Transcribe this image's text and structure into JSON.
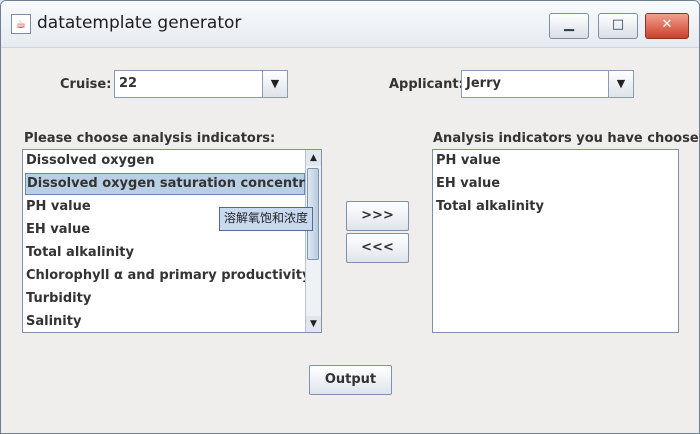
{
  "window": {
    "title": "datatemplate generator",
    "app_icon": "java-icon",
    "controls": {
      "minimize": "▁",
      "maximize": "□",
      "close": "✕"
    }
  },
  "cruise": {
    "label": "Cruise:",
    "value": "22"
  },
  "applicant": {
    "label": "Applicant:",
    "value": "Jerry"
  },
  "dropdown_arrow": "▼",
  "available": {
    "label": "Please choose analysis indicators:",
    "items": [
      "Dissolved oxygen",
      "Dissolved oxygen saturation concentration",
      "PH value",
      "EH value",
      "Total alkalinity",
      "Chlorophyll α and primary productivity",
      "Turbidity",
      "Salinity"
    ],
    "selected_index": 1,
    "scroll_up": "▲",
    "scroll_down": "▼"
  },
  "chosen": {
    "label": "Analysis indicators you have choosen:",
    "items": [
      "PH value",
      "EH value",
      "Total alkalinity"
    ]
  },
  "buttons": {
    "add": ">>>",
    "remove": "<<<",
    "output": "Output"
  },
  "tooltip": {
    "text": "溶解氧饱和浓度"
  }
}
